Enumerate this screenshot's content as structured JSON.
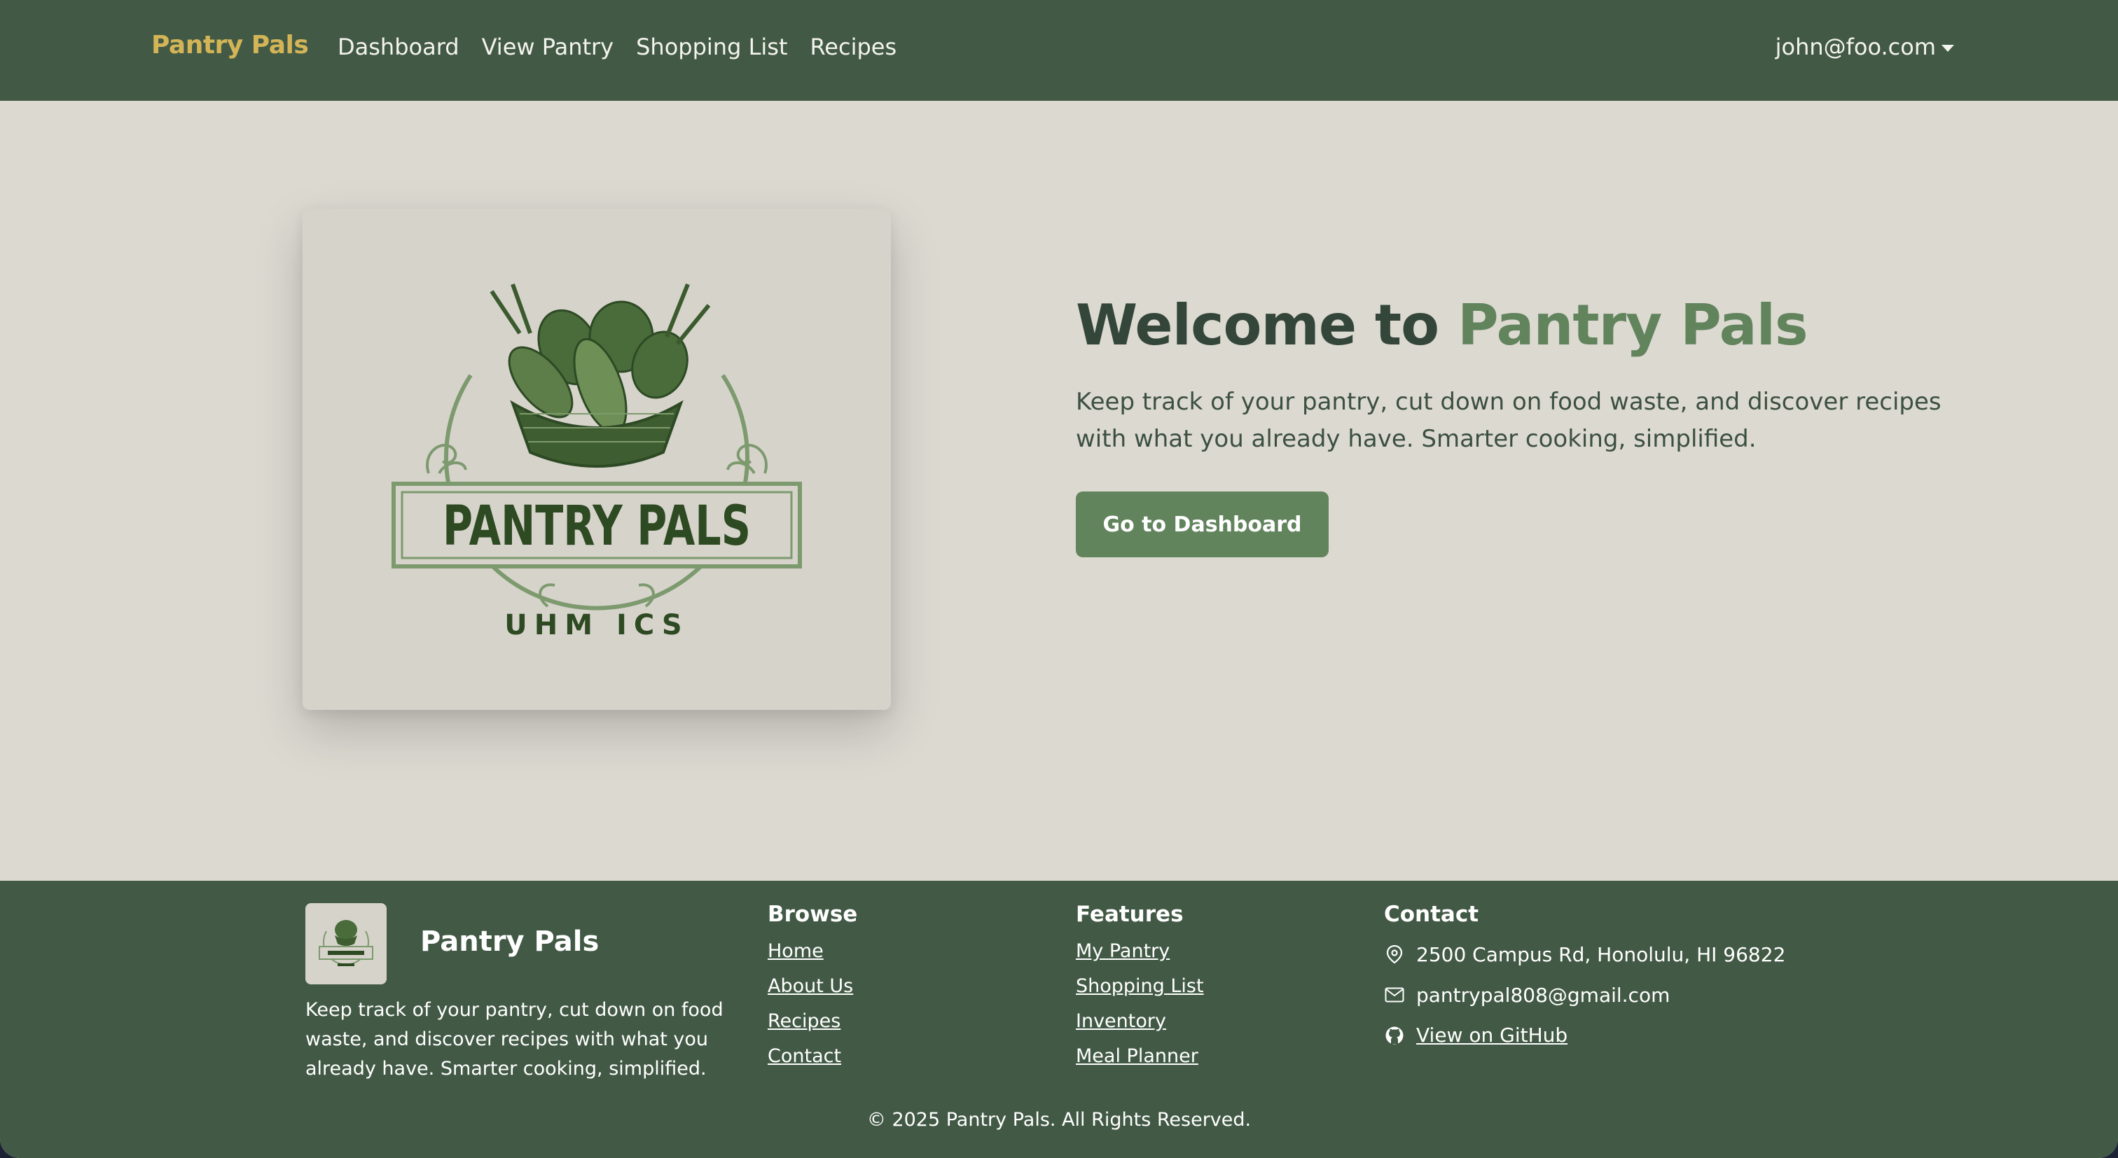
{
  "navbar": {
    "brand": "Pantry Pals",
    "links": [
      {
        "label": "Dashboard"
      },
      {
        "label": "View Pantry"
      },
      {
        "label": "Shopping List"
      },
      {
        "label": "Recipes"
      }
    ],
    "user_email": "john@foo.com"
  },
  "hero": {
    "logo_image_text": "PANTRY PALS",
    "logo_image_subtext": "UHM ICS",
    "title_prefix": "Welcome to ",
    "title_accent": "Pantry Pals",
    "subtitle": "Keep track of your pantry, cut down on food waste, and discover recipes with what you already have. Smarter cooking, simplified.",
    "cta_label": "Go to Dashboard"
  },
  "footer": {
    "brand_name": "Pantry Pals",
    "description": "Keep track of your pantry, cut down on food waste, and discover recipes with what you already have. Smarter cooking, simplified.",
    "browse": {
      "heading": "Browse",
      "links": [
        "Home",
        "About Us",
        "Recipes",
        "Contact"
      ]
    },
    "features": {
      "heading": "Features",
      "links": [
        "My Pantry",
        "Shopping List",
        "Inventory",
        "Meal Planner"
      ]
    },
    "contact": {
      "heading": "Contact",
      "address": "2500 Campus Rd, Honolulu, HI 96822",
      "email": "pantrypal808@gmail.com",
      "github_label": "View on GitHub"
    },
    "copyright": "© 2025 Pantry Pals. All Rights Reserved."
  },
  "colors": {
    "nav_bg": "#425a45",
    "brand_gold": "#d3b457",
    "page_bg": "#dcd9d1",
    "accent_green": "#62845d",
    "title_dark": "#34463a"
  },
  "icons": [
    "map-pin-icon",
    "envelope-icon",
    "github-icon",
    "caret-down-icon"
  ]
}
